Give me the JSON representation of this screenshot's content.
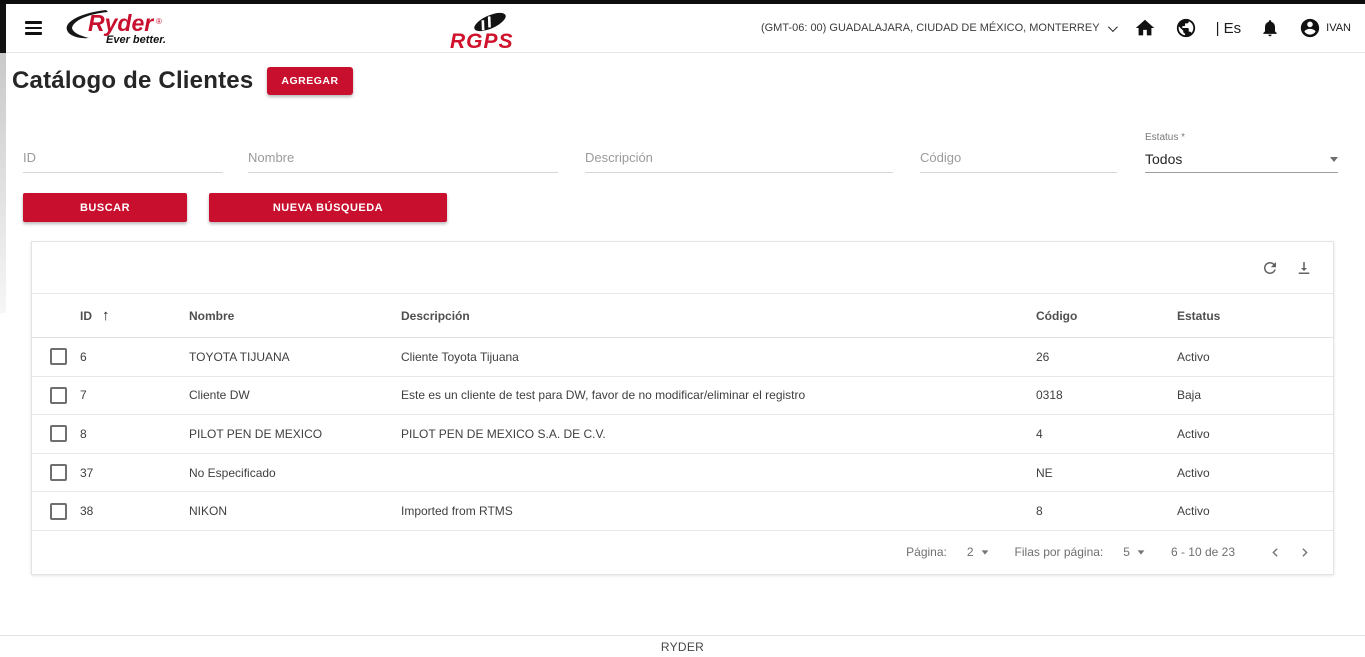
{
  "header": {
    "brand": {
      "name": "Ryder",
      "tagline": "Ever better.",
      "app": "RGPS"
    },
    "timezone": "(GMT-06: 00) GUADALAJARA, CIUDAD DE MÉXICO, MONTERREY",
    "language": "| Es",
    "username": "IVAN"
  },
  "page": {
    "title": "Catálogo de Clientes",
    "add_button": "AGREGAR",
    "footer": "RYDER"
  },
  "search": {
    "fields": [
      {
        "placeholder": "ID"
      },
      {
        "placeholder": "Nombre"
      },
      {
        "placeholder": "Descripción"
      },
      {
        "placeholder": "Código"
      }
    ],
    "estatus_label": "Estatus *",
    "estatus_value": "Todos",
    "buscar_label": "BUSCAR",
    "nueva_label": "NUEVA BÚSQUEDA"
  },
  "table": {
    "columns": [
      "ID",
      "Nombre",
      "Descripción",
      "Código",
      "Estatus"
    ],
    "sort_icon": "↑",
    "rows": [
      {
        "id": "6",
        "nombre": "TOYOTA TIJUANA",
        "descripcion": "Cliente Toyota Tijuana",
        "codigo": "26",
        "estatus": "Activo"
      },
      {
        "id": "7",
        "nombre": "Cliente DW",
        "descripcion": "Este es un cliente de test para DW, favor de no modificar/eliminar el registro",
        "codigo": "0318",
        "estatus": "Baja"
      },
      {
        "id": "8",
        "nombre": "PILOT PEN DE MEXICO",
        "descripcion": "PILOT PEN DE MEXICO S.A. DE C.V.",
        "codigo": "4",
        "estatus": "Activo"
      },
      {
        "id": "37",
        "nombre": "No Especificado",
        "descripcion": "",
        "codigo": "NE",
        "estatus": "Activo"
      },
      {
        "id": "38",
        "nombre": "NIKON",
        "descripcion": "Imported from RTMS",
        "codigo": "8",
        "estatus": "Activo"
      }
    ],
    "pagination": {
      "page_label": "Página:",
      "page_value": "2",
      "rows_label": "Filas por página:",
      "rows_value": "5",
      "range": "6 - 10 de 23"
    }
  },
  "icons": {
    "menu": "hamburger",
    "home": "house",
    "globe": "world",
    "bell": "notifications",
    "user": "account-circle",
    "refresh": "reload-arrow",
    "download": "arrow-to-line",
    "sort": "arrow-up",
    "prev": "chevron-left",
    "next": "chevron-right"
  },
  "colors": {
    "accent": "#C8102E",
    "logo_red": "#D0112B",
    "topbar": "#0d0d0d"
  }
}
